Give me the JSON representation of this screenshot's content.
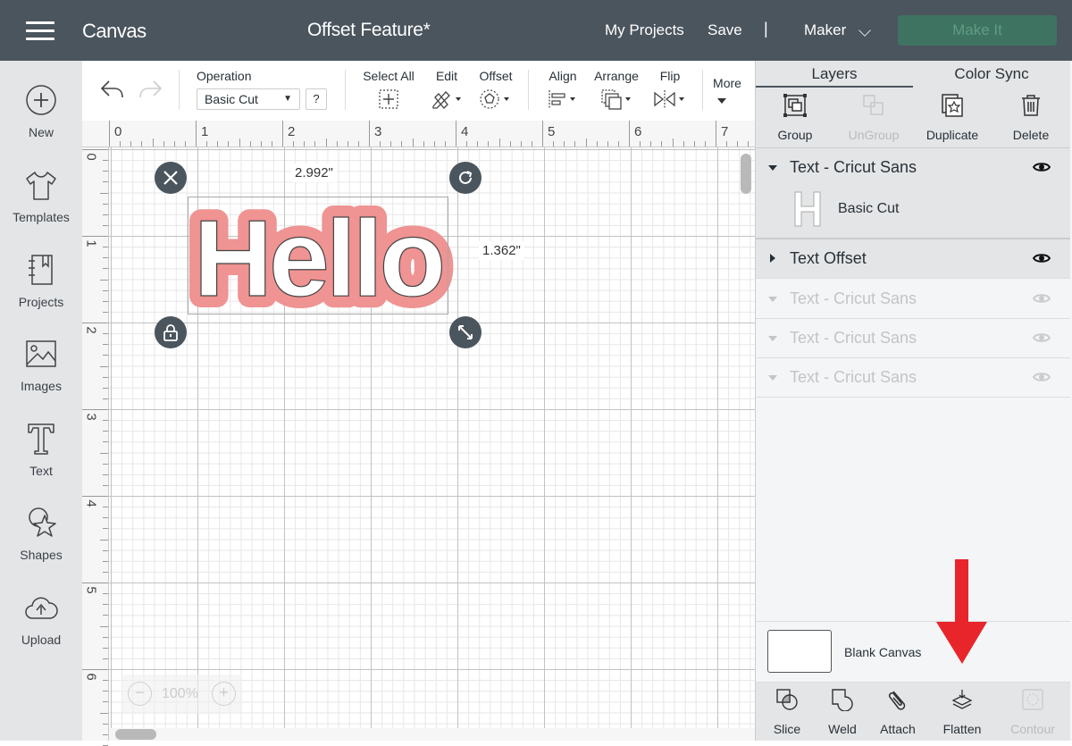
{
  "header": {
    "app_title": "Canvas",
    "document_title": "Offset Feature*",
    "nav": {
      "my_projects": "My Projects",
      "save": "Save",
      "separator": "|",
      "machine": "Maker"
    },
    "make_it": "Make It",
    "colors": {
      "bar": "#4b555e",
      "make_it_bg": "#3f7361"
    }
  },
  "sidebar": {
    "items": [
      {
        "label": "New",
        "icon": "plus-circle-icon"
      },
      {
        "label": "Templates",
        "icon": "tshirt-icon"
      },
      {
        "label": "Projects",
        "icon": "notebook-icon"
      },
      {
        "label": "Images",
        "icon": "image-icon"
      },
      {
        "label": "Text",
        "icon": "text-t-icon"
      },
      {
        "label": "Shapes",
        "icon": "shapes-icon"
      },
      {
        "label": "Upload",
        "icon": "cloud-upload-icon"
      }
    ]
  },
  "toolbar": {
    "undo_icon": "undo-icon",
    "redo_icon": "redo-icon",
    "operation": {
      "label": "Operation",
      "value": "Basic Cut",
      "help": "?"
    },
    "select_all": "Select All",
    "edit": "Edit",
    "offset": "Offset",
    "align": "Align",
    "arrange": "Arrange",
    "flip": "Flip",
    "more": "More"
  },
  "rulers": {
    "horizontal": [
      "0",
      "1",
      "2",
      "3",
      "4",
      "5",
      "6",
      "7"
    ],
    "vertical": [
      "0",
      "1",
      "2",
      "3",
      "4",
      "5",
      "6"
    ]
  },
  "canvas": {
    "text": "Hello",
    "width_label": "2.992\"",
    "height_label": "1.362\"",
    "offset_color": "#ef9393",
    "zoom": "100%",
    "zoom_out": "−",
    "zoom_in": "+"
  },
  "panel": {
    "tabs": [
      {
        "label": "Layers",
        "active": true
      },
      {
        "label": "Color Sync",
        "active": false
      }
    ],
    "tools": [
      {
        "label": "Group",
        "enabled": true
      },
      {
        "label": "UnGroup",
        "enabled": false
      },
      {
        "label": "Duplicate",
        "enabled": true
      },
      {
        "label": "Delete",
        "enabled": true
      }
    ],
    "layers": [
      {
        "name": "Text - Cricut Sans",
        "expanded": true,
        "sub": {
          "thumb": "H",
          "operation": "Basic Cut"
        },
        "visible": true,
        "dimmed": false
      },
      {
        "name": "Text Offset",
        "expanded": false,
        "visible": true,
        "dimmed": false
      },
      {
        "name": "Text - Cricut Sans",
        "expanded": true,
        "visible": true,
        "dimmed": true
      },
      {
        "name": "Text - Cricut Sans",
        "expanded": true,
        "visible": true,
        "dimmed": true
      },
      {
        "name": "Text - Cricut Sans",
        "expanded": true,
        "visible": true,
        "dimmed": true
      }
    ],
    "blank_canvas": "Blank Canvas",
    "bottom_tools": [
      {
        "label": "Slice",
        "enabled": true
      },
      {
        "label": "Weld",
        "enabled": true
      },
      {
        "label": "Attach",
        "enabled": true
      },
      {
        "label": "Flatten",
        "enabled": true
      },
      {
        "label": "Contour",
        "enabled": false
      }
    ],
    "annotation_arrow_color": "#e8252b"
  }
}
